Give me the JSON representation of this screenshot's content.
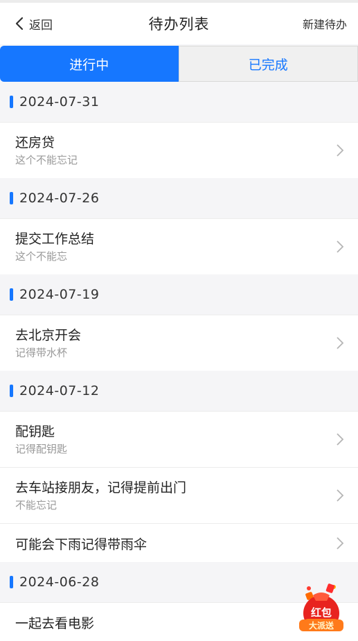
{
  "nav": {
    "back_label": "返回",
    "title": "待办列表",
    "new_label": "新建待办"
  },
  "tabs": {
    "active": "进行中",
    "inactive": "已完成"
  },
  "groups": [
    {
      "date": "2024-07-31",
      "items": [
        {
          "title": "还房贷",
          "sub": "这个不能忘记"
        }
      ]
    },
    {
      "date": "2024-07-26",
      "items": [
        {
          "title": "提交工作总结",
          "sub": "这个不能忘"
        }
      ]
    },
    {
      "date": "2024-07-19",
      "items": [
        {
          "title": "去北京开会",
          "sub": "记得带水杯"
        }
      ]
    },
    {
      "date": "2024-07-12",
      "items": [
        {
          "title": "配钥匙",
          "sub": "记得配钥匙"
        },
        {
          "title": "去车站接朋友，记得提前出门",
          "sub": "不能忘记"
        },
        {
          "title": "可能会下雨记得带雨伞",
          "sub": ""
        }
      ]
    },
    {
      "date": "2024-06-28",
      "items": [
        {
          "title": "一起去看电影",
          "sub": ""
        }
      ]
    }
  ],
  "promo": {
    "line1": "红包",
    "line2": "大派送"
  },
  "icons": {
    "back": "chevron-left-icon",
    "row": "chevron-right-icon"
  },
  "colors": {
    "accent": "#1677ff",
    "background": "#f5f5f7"
  }
}
